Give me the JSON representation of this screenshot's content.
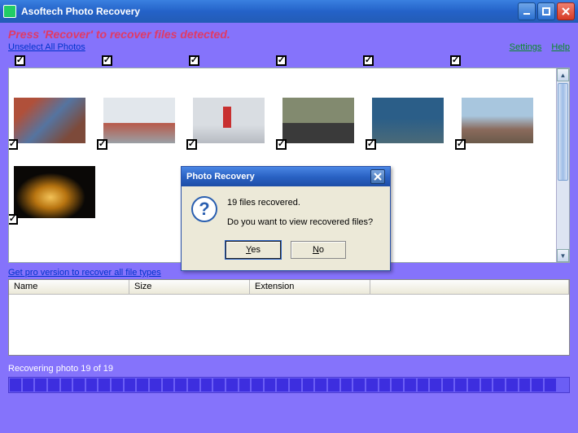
{
  "window": {
    "title": "Asoftech Photo Recovery"
  },
  "instruction": "Press 'Recover' to recover files detected.",
  "links": {
    "unselect": "Unselect All Photos",
    "settings": "Settings",
    "help": "Help",
    "pro": "Get pro version to recover all file types"
  },
  "table": {
    "headers": {
      "name": "Name",
      "size": "Size",
      "extension": "Extension"
    }
  },
  "status": "Recovering photo 19 of 19",
  "dialog": {
    "title": "Photo Recovery",
    "line1": "19 files recovered.",
    "line2": "Do you want to view recovered files?",
    "yes": "Yes",
    "no": "No"
  }
}
